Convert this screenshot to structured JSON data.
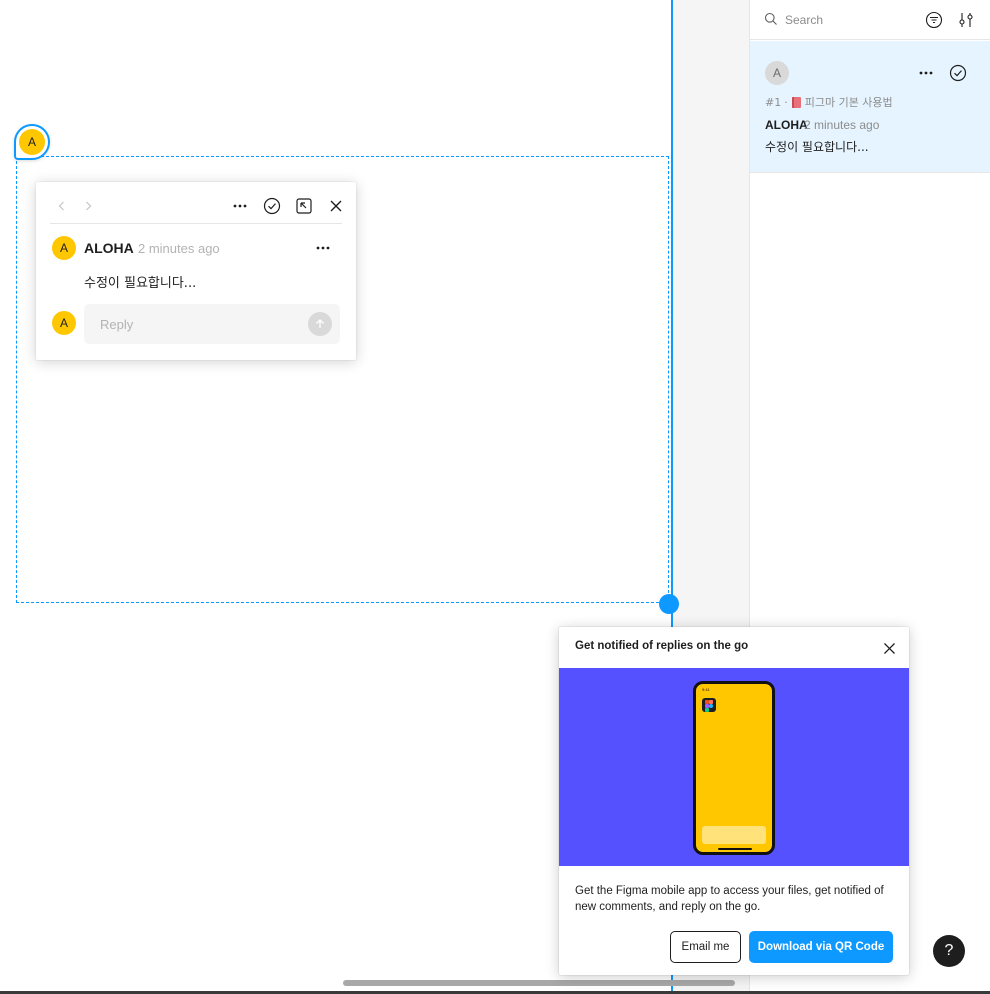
{
  "colors": {
    "accent": "#0d99ff",
    "avatar_yellow": "#ffc700",
    "promo_purple": "#5551ff",
    "card_highlight": "#e5f4ff"
  },
  "canvas": {
    "pin": {
      "initial": "A"
    },
    "thread": {
      "toolbar": {
        "prev_icon": "chevron-left-icon",
        "next_icon": "chevron-right-icon",
        "more_icon": "more-horizontal-icon",
        "resolve_icon": "check-circle-icon",
        "open_icon": "open-in-panel-icon",
        "close_icon": "close-icon"
      },
      "message": {
        "avatar_initial": "A",
        "author": "ALOHA",
        "time": "2 minutes ago",
        "body": "수정이 필요합니다..."
      },
      "reply": {
        "avatar_initial": "A",
        "placeholder": "Reply",
        "send_icon": "arrow-up-icon"
      }
    }
  },
  "panel": {
    "search": {
      "placeholder": "Search",
      "search_icon": "search-icon",
      "filter_icon": "filter-icon",
      "prefs_icon": "adjust-icon"
    },
    "comments": [
      {
        "avatar_initial": "A",
        "number": "#1",
        "separator": "·",
        "page_name": "피그마 기본 사용법",
        "author": "ALOHA",
        "time": "2 minutes ago",
        "body": "수정이 필요합니다..."
      }
    ]
  },
  "notify": {
    "title": "Get notified of replies on the go",
    "description": "Get the Figma mobile app to access your files, get notified of new comments, and reply on the go.",
    "email_button": "Email me",
    "qr_button": "Download via QR Code",
    "phone_time": "9:41"
  },
  "help": {
    "label": "?"
  }
}
